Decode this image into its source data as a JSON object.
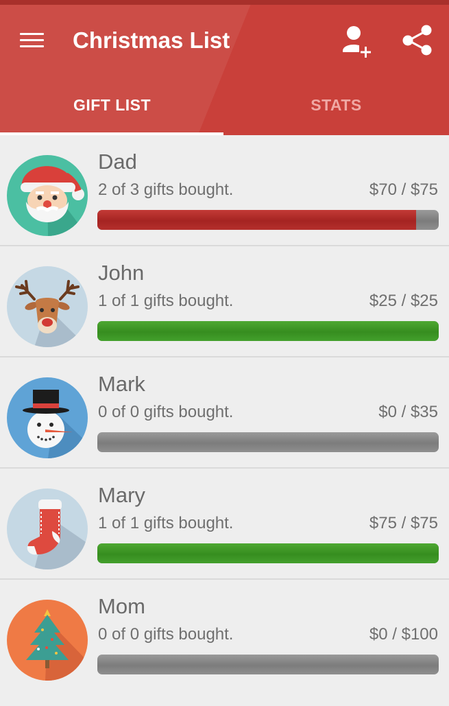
{
  "app": {
    "title": "Christmas List",
    "icons": [
      "menu-icon",
      "add-person-icon",
      "share-icon"
    ]
  },
  "tabs": [
    {
      "label": "GIFT LIST",
      "active": true
    },
    {
      "label": "STATS",
      "active": false
    }
  ],
  "colors": {
    "primary": "#c9403a",
    "progress_red": "#a52422",
    "progress_green": "#368d1f",
    "progress_empty": "#8a8a8a"
  },
  "people": [
    {
      "name": "Dad",
      "gifts_text": "2 of 3 gifts bought.",
      "amount_text": "$70 / $75",
      "progress": 0.933,
      "bar_color": "red",
      "avatar": "santa-avatar"
    },
    {
      "name": "John",
      "gifts_text": "1 of 1 gifts bought.",
      "amount_text": "$25 / $25",
      "progress": 1.0,
      "bar_color": "green",
      "avatar": "reindeer-avatar"
    },
    {
      "name": "Mark",
      "gifts_text": "0 of 0 gifts bought.",
      "amount_text": "$0 / $35",
      "progress": 0,
      "bar_color": "gray",
      "avatar": "snowman-avatar"
    },
    {
      "name": "Mary",
      "gifts_text": "1 of 1 gifts bought.",
      "amount_text": "$75 / $75",
      "progress": 1.0,
      "bar_color": "green",
      "avatar": "stocking-avatar"
    },
    {
      "name": "Mom",
      "gifts_text": "0 of 0 gifts bought.",
      "amount_text": "$0 / $100",
      "progress": 0,
      "bar_color": "gray",
      "avatar": "christmas-tree-avatar"
    }
  ]
}
